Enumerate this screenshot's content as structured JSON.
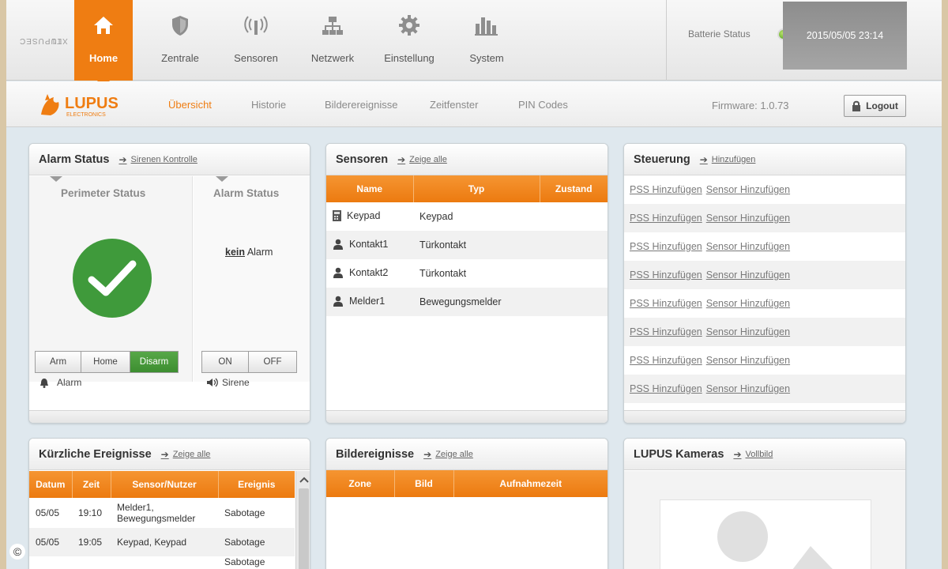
{
  "brand": {
    "line1": "LUPUSEC",
    "line2": "XT1"
  },
  "nav": [
    {
      "label": "Home",
      "icon": "home-icon",
      "active": true
    },
    {
      "label": "Zentrale",
      "icon": "shield-icon"
    },
    {
      "label": "Sensoren",
      "icon": "sensor-wave-icon"
    },
    {
      "label": "Netzwerk",
      "icon": "network-icon"
    },
    {
      "label": "Einstellung",
      "icon": "gear-icon"
    },
    {
      "label": "System",
      "icon": "bars-icon"
    }
  ],
  "status": {
    "battery_label": "Batterie Status",
    "battery_color": "#4c9d1c",
    "datetime": "2015/05/05 23:14"
  },
  "logo": {
    "text": "LUPUS",
    "subtext": "ELECTRONICS"
  },
  "subnav": [
    {
      "label": "Übersicht",
      "active": true
    },
    {
      "label": "Historie"
    },
    {
      "label": "Bilderereignisse"
    },
    {
      "label": "Zeitfenster"
    },
    {
      "label": "PIN Codes"
    }
  ],
  "firmware": "Firmware: 1.0.73",
  "logout": "Logout",
  "colors": {
    "accent": "#ef7d12",
    "ok_green": "#3f9a3b"
  },
  "alarm_panel": {
    "title": "Alarm Status",
    "link": "Sirenen Kontrolle",
    "perimeter_title": "Perimeter Status",
    "alarm_title": "Alarm Status",
    "alarm_state_bold": "kein",
    "alarm_state_rest": "Alarm",
    "mode_buttons": [
      "Arm",
      "Home",
      "Disarm"
    ],
    "mode_active": "Disarm",
    "alarm_label": "Alarm",
    "siren_buttons": [
      "ON",
      "OFF"
    ],
    "siren_label": "Sirene"
  },
  "sensors_panel": {
    "title": "Sensoren",
    "link": "Zeige alle",
    "columns": [
      "Name",
      "Typ",
      "Zustand"
    ],
    "rows": [
      {
        "icon": "keypad-icon",
        "name": "Keypad",
        "type": "Keypad",
        "state": ""
      },
      {
        "icon": "person-icon",
        "name": "Kontakt1",
        "type": "Türkontakt",
        "state": ""
      },
      {
        "icon": "person-icon",
        "name": "Kontakt2",
        "type": "Türkontakt",
        "state": ""
      },
      {
        "icon": "person-icon",
        "name": "Melder1",
        "type": "Bewegungsmelder",
        "state": ""
      }
    ]
  },
  "control_panel": {
    "title": "Steuerung",
    "link": "Hinzufügen",
    "rows": [
      [
        "PSS Hinzufügen",
        "Sensor Hinzufügen"
      ],
      [
        "PSS Hinzufügen",
        "Sensor Hinzufügen"
      ],
      [
        "PSS Hinzufügen",
        "Sensor Hinzufügen"
      ],
      [
        "PSS Hinzufügen",
        "Sensor Hinzufügen"
      ],
      [
        "PSS Hinzufügen",
        "Sensor Hinzufügen"
      ],
      [
        "PSS Hinzufügen",
        "Sensor Hinzufügen"
      ],
      [
        "PSS Hinzufügen",
        "Sensor Hinzufügen"
      ],
      [
        "PSS Hinzufügen",
        "Sensor Hinzufügen"
      ]
    ]
  },
  "events_panel": {
    "title": "Kürzliche Ereignisse",
    "link": "Zeige alle",
    "columns": [
      "Datum",
      "Zeit",
      "Sensor/Nutzer",
      "Ereignis"
    ],
    "rows": [
      {
        "date": "05/05",
        "time": "19:10",
        "sensor": "Melder1, Bewegungsmelder",
        "event": "Sabotage"
      },
      {
        "date": "05/05",
        "time": "19:05",
        "sensor": "Keypad, Keypad",
        "event": "Sabotage"
      },
      {
        "date": "",
        "time": "",
        "sensor": "",
        "event": "Sabotage"
      }
    ]
  },
  "images_panel": {
    "title": "Bildereignisse",
    "link": "Zeige alle",
    "columns": [
      "Zone",
      "Bild",
      "Aufnahmezeit"
    ]
  },
  "cameras_panel": {
    "title": "LUPUS Kameras",
    "link": "Vollbild"
  },
  "copyright": "©"
}
